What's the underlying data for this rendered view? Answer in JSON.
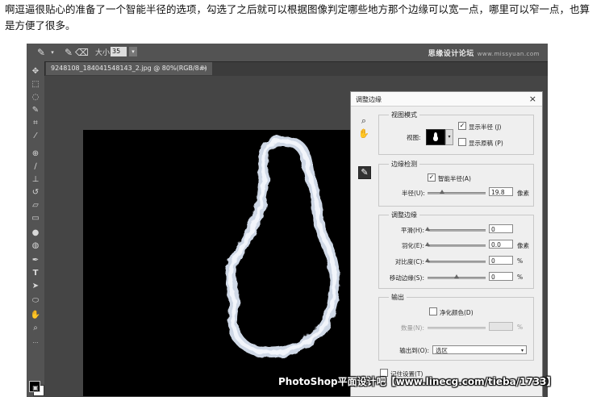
{
  "caption": "啊逗逼很贴心的准备了一个智能半径的选项，勾选了之后就可以根据图像判定哪些地方那个边缘可以宽一点，哪里可以窄一点，也算是方便了很多。",
  "options_bar": {
    "size_label": "大小:",
    "size_value": "35",
    "site_logo": "思缘设计论坛",
    "site_url": "www.missyuan.com"
  },
  "document": {
    "tab_title": "9248108_184041548143_2.jpg @ 80%(RGB/8#) *",
    "tab_close": "×"
  },
  "dialog": {
    "title": "调整边缘",
    "close": "×",
    "view_mode": {
      "section": "视图模式",
      "view_label": "视图:",
      "show_radius": "显示半径 (J)",
      "show_radius_checked": true,
      "show_original": "显示原稿 (P)",
      "show_original_checked": false
    },
    "edge_detection": {
      "section": "边缘检测",
      "smart_radius": "智能半径(A)",
      "smart_radius_checked": true,
      "radius_label": "半径(U):",
      "radius_value": "19.8",
      "radius_unit": "像素",
      "radius_fraction": 0.25
    },
    "adjust_edge": {
      "section": "调整边缘",
      "rows": [
        {
          "label": "平滑(H):",
          "value": "0",
          "unit": "",
          "fraction": 0.0
        },
        {
          "label": "羽化(E):",
          "value": "0.0",
          "unit": "像素",
          "fraction": 0.0
        },
        {
          "label": "对比度(C):",
          "value": "0",
          "unit": "%",
          "fraction": 0.0
        },
        {
          "label": "移动边缘(S):",
          "value": "0",
          "unit": "%",
          "fraction": 0.5
        }
      ]
    },
    "output": {
      "section": "输出",
      "decontaminate": "净化颜色(D)",
      "decontaminate_checked": false,
      "amount_label": "数量(N):",
      "amount_unit": "%",
      "output_to_label": "输出到(O):",
      "output_to_value": "选区"
    },
    "remember": "记住设置(T)",
    "remember_checked": false
  },
  "watermark": "PhotoShop平面设计吧【www.linecg.com/tieba/1733】"
}
